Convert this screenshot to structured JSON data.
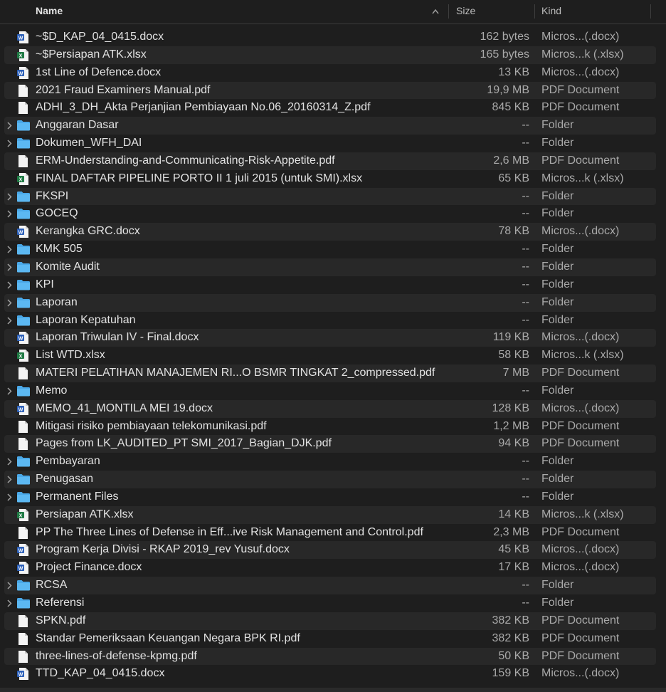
{
  "columns": {
    "name": "Name",
    "size": "Size",
    "kind": "Kind"
  },
  "files": [
    {
      "name": "~$D_KAP_04_0415.docx",
      "size": "162 bytes",
      "kind": "Micros...(.docx)",
      "type": "docx"
    },
    {
      "name": "~$Persiapan ATK.xlsx",
      "size": "165 bytes",
      "kind": "Micros...k (.xlsx)",
      "type": "xlsx"
    },
    {
      "name": "1st Line of Defence.docx",
      "size": "13 KB",
      "kind": "Micros...(.docx)",
      "type": "docx"
    },
    {
      "name": "2021 Fraud Examiners Manual.pdf",
      "size": "19,9 MB",
      "kind": "PDF Document",
      "type": "pdf"
    },
    {
      "name": "ADHI_3_DH_Akta Perjanjian Pembiayaan No.06_20160314_Z.pdf",
      "size": "845 KB",
      "kind": "PDF Document",
      "type": "pdf"
    },
    {
      "name": "Anggaran Dasar",
      "size": "--",
      "kind": "Folder",
      "type": "folder"
    },
    {
      "name": "Dokumen_WFH_DAI",
      "size": "--",
      "kind": "Folder",
      "type": "folder"
    },
    {
      "name": "ERM-Understanding-and-Communicating-Risk-Appetite.pdf",
      "size": "2,6 MB",
      "kind": "PDF Document",
      "type": "pdf"
    },
    {
      "name": "FINAL DAFTAR PIPELINE PORTO II 1 juli 2015 (untuk SMI).xlsx",
      "size": "65 KB",
      "kind": "Micros...k (.xlsx)",
      "type": "xlsx"
    },
    {
      "name": "FKSPI",
      "size": "--",
      "kind": "Folder",
      "type": "folder"
    },
    {
      "name": "GOCEQ",
      "size": "--",
      "kind": "Folder",
      "type": "folder"
    },
    {
      "name": "Kerangka GRC.docx",
      "size": "78 KB",
      "kind": "Micros...(.docx)",
      "type": "docx"
    },
    {
      "name": "KMK 505",
      "size": "--",
      "kind": "Folder",
      "type": "folder"
    },
    {
      "name": "Komite Audit",
      "size": "--",
      "kind": "Folder",
      "type": "folder"
    },
    {
      "name": "KPI",
      "size": "--",
      "kind": "Folder",
      "type": "folder"
    },
    {
      "name": "Laporan",
      "size": "--",
      "kind": "Folder",
      "type": "folder"
    },
    {
      "name": "Laporan Kepatuhan",
      "size": "--",
      "kind": "Folder",
      "type": "folder"
    },
    {
      "name": "Laporan Triwulan IV - Final.docx",
      "size": "119 KB",
      "kind": "Micros...(.docx)",
      "type": "docx"
    },
    {
      "name": "List WTD.xlsx",
      "size": "58 KB",
      "kind": "Micros...k (.xlsx)",
      "type": "xlsx"
    },
    {
      "name": "MATERI PELATIHAN MANAJEMEN RI...O BSMR TINGKAT 2_compressed.pdf",
      "size": "7 MB",
      "kind": "PDF Document",
      "type": "pdf"
    },
    {
      "name": "Memo",
      "size": "--",
      "kind": "Folder",
      "type": "folder"
    },
    {
      "name": "MEMO_41_MONTILA MEI 19.docx",
      "size": "128 KB",
      "kind": "Micros...(.docx)",
      "type": "docx"
    },
    {
      "name": "Mitigasi risiko pembiayaan telekomunikasi.pdf",
      "size": "1,2 MB",
      "kind": "PDF Document",
      "type": "pdf"
    },
    {
      "name": "Pages from LK_AUDITED_PT SMI_2017_Bagian_DJK.pdf",
      "size": "94 KB",
      "kind": "PDF Document",
      "type": "pdf"
    },
    {
      "name": "Pembayaran",
      "size": "--",
      "kind": "Folder",
      "type": "folder"
    },
    {
      "name": "Penugasan",
      "size": "--",
      "kind": "Folder",
      "type": "folder"
    },
    {
      "name": "Permanent Files",
      "size": "--",
      "kind": "Folder",
      "type": "folder"
    },
    {
      "name": "Persiapan ATK.xlsx",
      "size": "14 KB",
      "kind": "Micros...k (.xlsx)",
      "type": "xlsx"
    },
    {
      "name": "PP The Three Lines of Defense in Eff...ive Risk Management and Control.pdf",
      "size": "2,3 MB",
      "kind": "PDF Document",
      "type": "pdf"
    },
    {
      "name": "Program Kerja Divisi - RKAP 2019_rev Yusuf.docx",
      "size": "45 KB",
      "kind": "Micros...(.docx)",
      "type": "docx"
    },
    {
      "name": "Project Finance.docx",
      "size": "17 KB",
      "kind": "Micros...(.docx)",
      "type": "docx"
    },
    {
      "name": "RCSA",
      "size": "--",
      "kind": "Folder",
      "type": "folder"
    },
    {
      "name": "Referensi",
      "size": "--",
      "kind": "Folder",
      "type": "folder"
    },
    {
      "name": "SPKN.pdf",
      "size": "382 KB",
      "kind": "PDF Document",
      "type": "pdf"
    },
    {
      "name": "Standar Pemeriksaan Keuangan Negara BPK RI.pdf",
      "size": "382 KB",
      "kind": "PDF Document",
      "type": "pdf"
    },
    {
      "name": "three-lines-of-defense-kpmg.pdf",
      "size": "50 KB",
      "kind": "PDF Document",
      "type": "pdf"
    },
    {
      "name": "TTD_KAP_04_0415.docx",
      "size": "159 KB",
      "kind": "Micros...(.docx)",
      "type": "docx"
    }
  ],
  "colors": {
    "background": "#1e1e1e",
    "row_alt": "#282828",
    "folder": "#4aa8e8",
    "word": "#2b5fb8",
    "excel": "#1f7a44"
  }
}
